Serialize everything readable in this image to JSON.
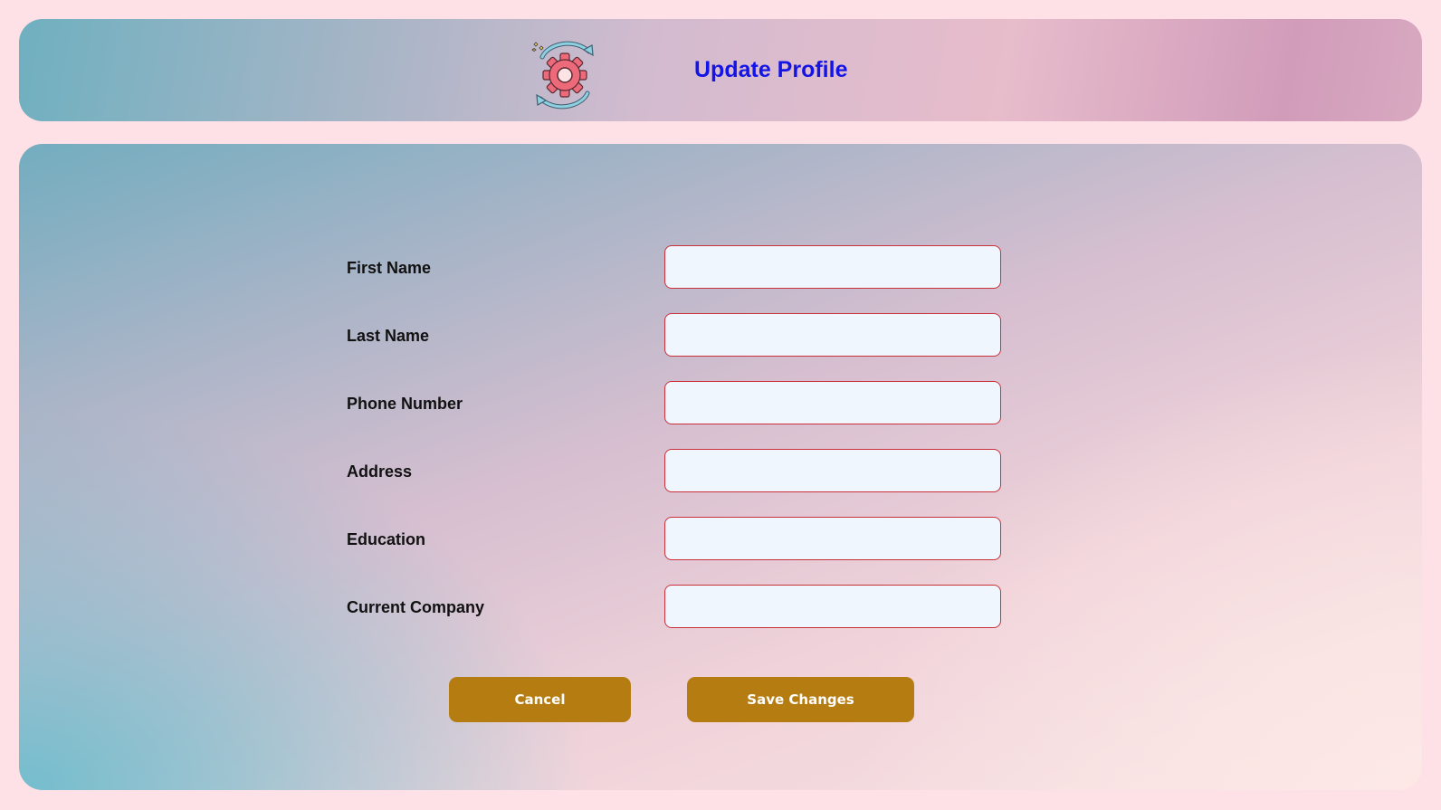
{
  "header": {
    "icon": "gear-refresh-icon",
    "title": "Update Profile"
  },
  "form": {
    "fields": [
      {
        "label": "First Name",
        "value": "",
        "placeholder": ""
      },
      {
        "label": "Last Name",
        "value": "",
        "placeholder": ""
      },
      {
        "label": "Phone Number",
        "value": "",
        "placeholder": ""
      },
      {
        "label": "Address",
        "value": "",
        "placeholder": ""
      },
      {
        "label": "Education",
        "value": "",
        "placeholder": ""
      },
      {
        "label": "Current Company",
        "value": "",
        "placeholder": ""
      }
    ]
  },
  "actions": {
    "cancel_label": "Cancel",
    "save_label": "Save Changes"
  },
  "colors": {
    "page_background": "#fde1e6",
    "title": "#1414e6",
    "input_border": "#c9303a",
    "input_background": "#eff6fd",
    "button": "#b57c11",
    "button_text": "#ffffff",
    "icon_gear": "#ec6a7a",
    "icon_arrows": "#6fb6cc"
  }
}
